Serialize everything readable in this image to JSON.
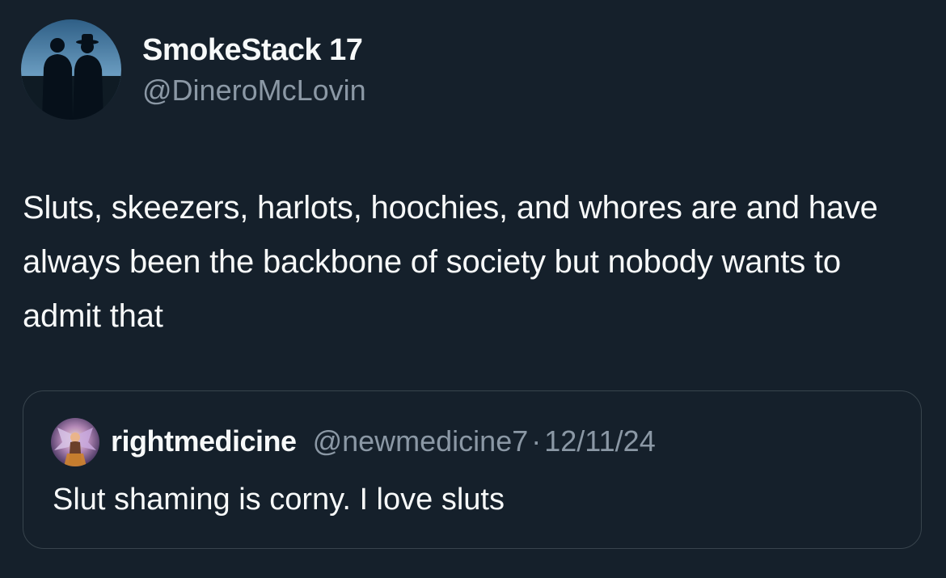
{
  "tweet": {
    "author": {
      "display_name": "SmokeStack 17",
      "handle": "@DineroMcLovin",
      "avatar_icon": "avatar-two-men-silhouette"
    },
    "text": "Sluts, skeezers, harlots, hoochies, and whores are and have always been the backbone of society but nobody wants to admit that"
  },
  "quoted_tweet": {
    "author": {
      "display_name": "rightmedicine",
      "handle": "@newmedicine7",
      "avatar_icon": "avatar-winged-figure"
    },
    "separator": "·",
    "date": "12/11/24",
    "text": "Slut shaming is corny. I love sluts"
  },
  "colors": {
    "background": "#15202b",
    "primary_text": "#f7f9f9",
    "secondary_text": "#8b98a5",
    "border": "#38444d"
  }
}
